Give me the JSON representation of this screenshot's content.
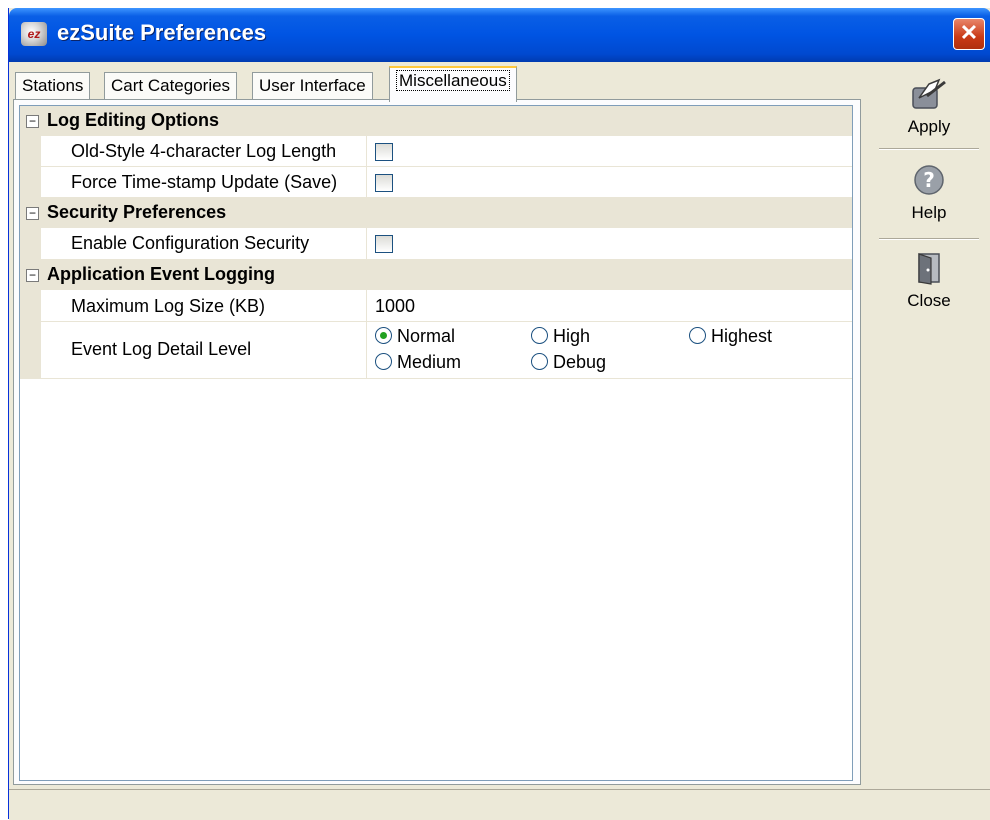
{
  "window": {
    "title": "ezSuite Preferences",
    "icon_text": "ez",
    "close_label": "✕"
  },
  "tabs": [
    {
      "label": "Stations"
    },
    {
      "label": "Cart Categories"
    },
    {
      "label": "User Interface"
    },
    {
      "label": "Miscellaneous",
      "active": true
    }
  ],
  "grid": {
    "categories": [
      {
        "label": "Log Editing Options",
        "expander": "⊟",
        "properties": [
          {
            "name": "Old-Style 4-character Log Length",
            "type": "checkbox",
            "checked": false
          },
          {
            "name": "Force Time-stamp Update (Save)",
            "type": "checkbox",
            "checked": false
          }
        ]
      },
      {
        "label": "Security Preferences",
        "expander": "⊟",
        "properties": [
          {
            "name": "Enable Configuration Security",
            "type": "checkbox",
            "checked": false
          }
        ]
      },
      {
        "label": "Application Event Logging",
        "expander": "⊟",
        "properties": [
          {
            "name": "Maximum Log Size (KB)",
            "type": "text",
            "value": "1000"
          },
          {
            "name": "Event Log Detail Level",
            "type": "radio",
            "selected": "Normal",
            "options": [
              "Normal",
              "High",
              "Highest",
              "Medium",
              "Debug"
            ]
          }
        ]
      }
    ]
  },
  "side_buttons": {
    "apply": {
      "label": "Apply",
      "icon": "apply-icon"
    },
    "help": {
      "label": "Help",
      "icon": "help-icon"
    },
    "close": {
      "label": "Close",
      "icon": "door-icon"
    }
  },
  "colors": {
    "titlebar": "#0054e3",
    "active_tab_accent": "#ffc83c",
    "radio_selected": "#21a121"
  }
}
